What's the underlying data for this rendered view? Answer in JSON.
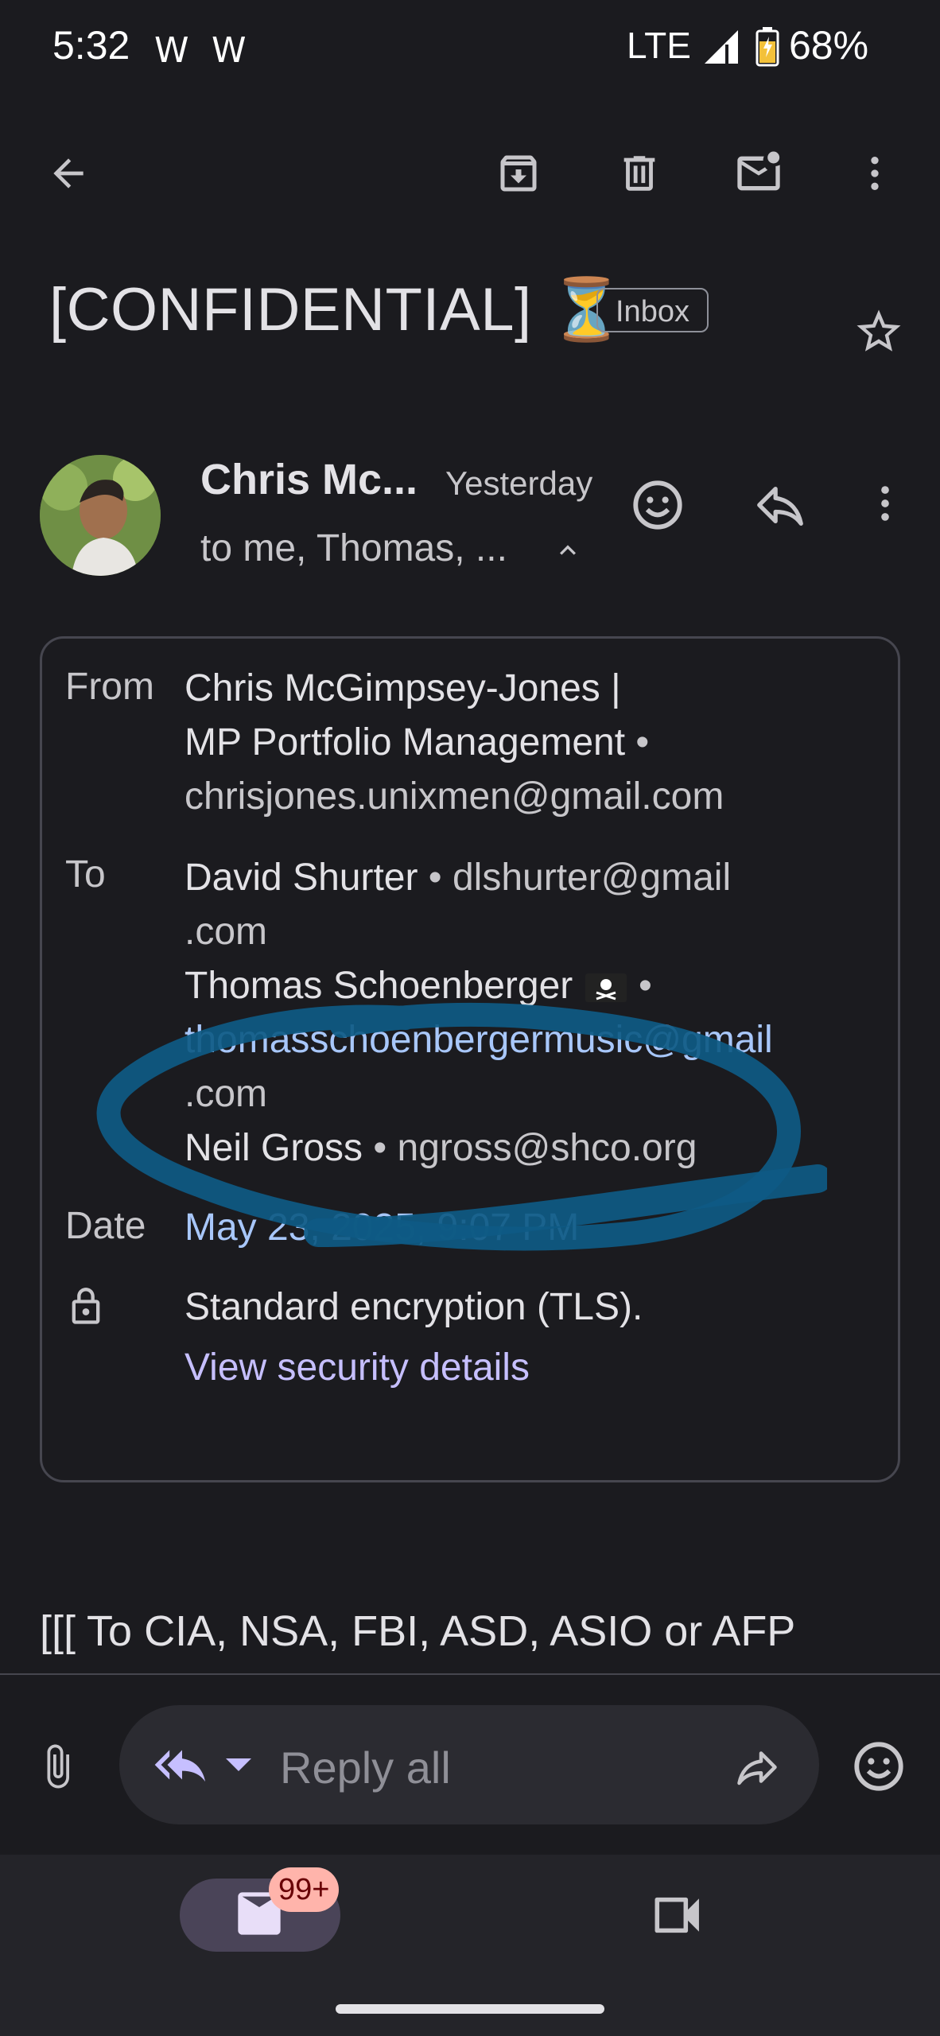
{
  "status_bar": {
    "time": "5:32",
    "notif_1": "W",
    "notif_2": "W",
    "network": "LTE",
    "battery": "68%"
  },
  "toolbar": {
    "back": "arrow-left-icon",
    "archive": "archive-icon",
    "delete": "trash-icon",
    "mark_unread": "mail-unread-icon",
    "more": "more-vert-icon"
  },
  "email": {
    "subject": "[CONFIDENTIAL] ⏳",
    "label": "Inbox",
    "sender_short": "Chris Mc...",
    "time": "Yesterday",
    "recipients_short": "to me, Thomas, ...",
    "details": {
      "from_label": "From",
      "from_name_1": "Chris McGimpsey-Jones |",
      "from_name_2": "MP Portfolio Management",
      "from_email": "chrisjones.unixmen@gmail.com",
      "to_label": "To",
      "to_1_name": "David Shurter",
      "to_1_email_a": "dlshurter@gmail",
      "to_1_email_b": ".com",
      "to_2_name": "Thomas Schoenberger",
      "to_2_email_a": "thomasschoenbergermusic@gmail",
      "to_2_email_b": ".com",
      "to_3_name": "Neil Gross",
      "to_3_email": "ngross@shco.org",
      "date_label": "Date",
      "date_value": "May 23, 2025, 9:07 PM",
      "security_text": "Standard encryption (TLS).",
      "security_link": "View security details"
    },
    "body_first_line": "[[[ To CIA, NSA, FBI, ASD, ASIO or AFP"
  },
  "reply_bar": {
    "placeholder": "Reply all"
  },
  "bottom_nav": {
    "mail_badge": "99+"
  },
  "colors": {
    "background": "#1b1b1f",
    "link_purple": "#c6bfff",
    "link_blue": "#a8c7fa",
    "annotation": "#0e5a84",
    "badge": "#ffb4ab"
  }
}
